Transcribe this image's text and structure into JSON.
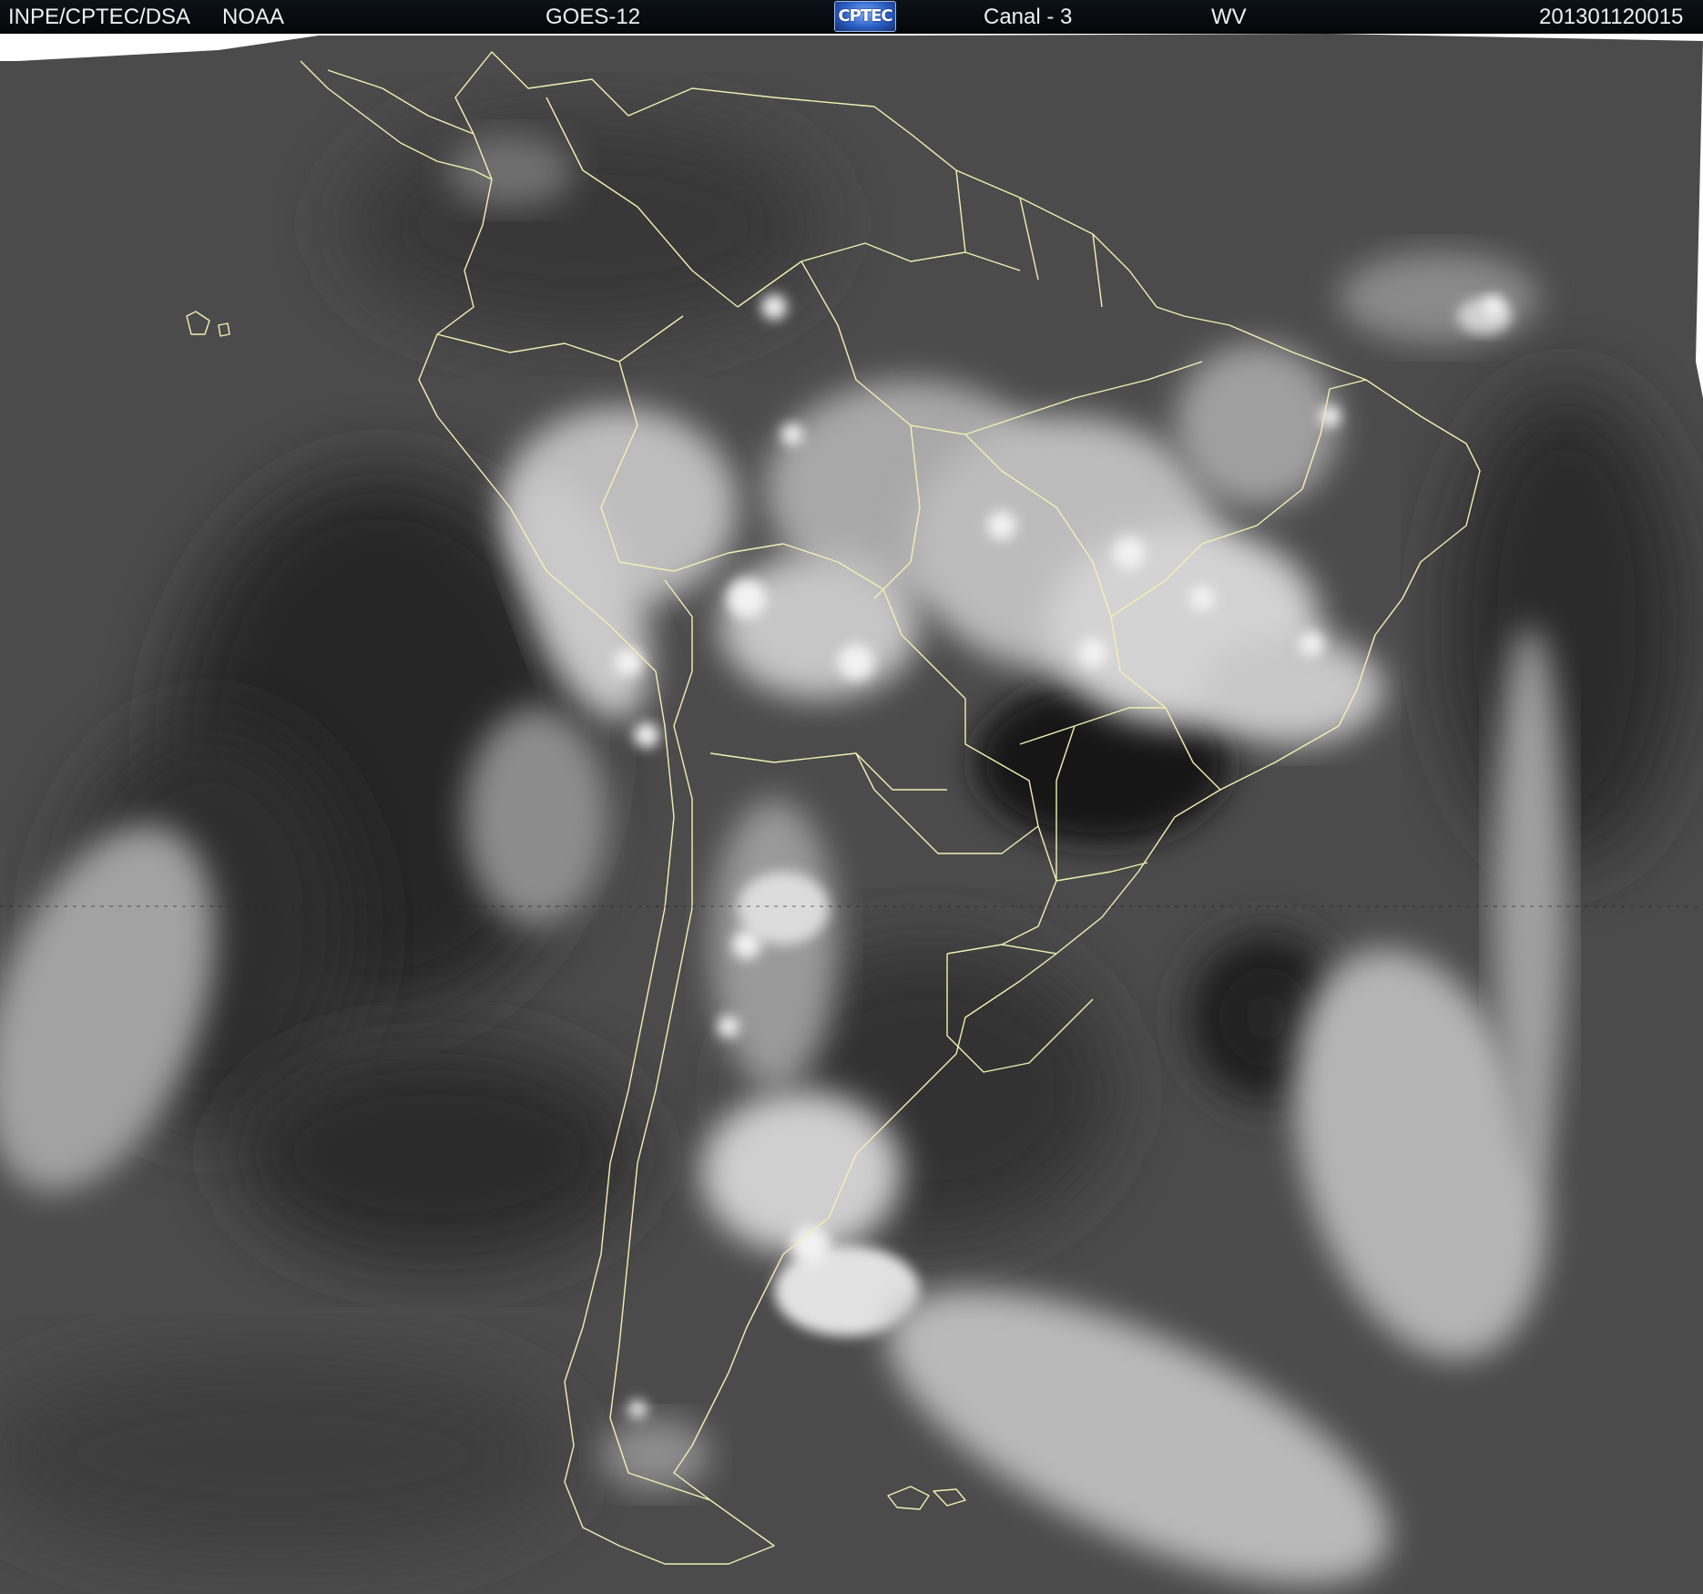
{
  "header": {
    "organization": "INPE/CPTEC/DSA",
    "agency": "NOAA",
    "satellite": "GOES-12",
    "logo_text": "CPTEC",
    "channel": "Canal - 3",
    "band": "WV",
    "timestamp": "201301120015"
  },
  "colors": {
    "header_background": "#070a0e",
    "header_text": "#f0f0f0",
    "border_lines": "#f2f0b4",
    "image_base": "#4a4a4a"
  },
  "map": {
    "region": "South America",
    "projection_outline": "political boundaries",
    "imagery_type": "water vapor grayscale"
  }
}
